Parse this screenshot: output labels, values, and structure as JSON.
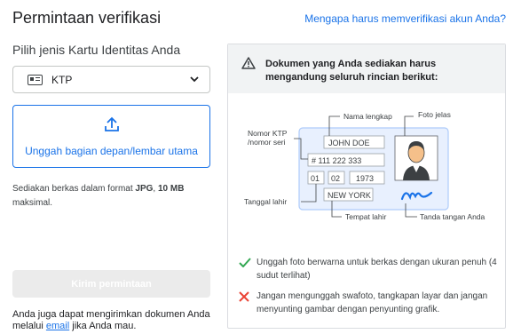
{
  "header": {
    "title": "Permintaan verifikasi",
    "why_link": "Mengapa harus memverifikasi akun Anda?"
  },
  "form": {
    "choose_label": "Pilih jenis Kartu Identitas Anda",
    "selected_id": "KTP",
    "upload_label": "Unggah bagian depan/lembar utama",
    "file_hint_prefix": "Sediakan berkas dalam format ",
    "file_hint_format": "JPG",
    "file_hint_sep": ", ",
    "file_hint_size": "10 MB",
    "file_hint_suffix": " maksimal.",
    "submit_label": "Kirim permintaan",
    "alt_prefix": "Anda juga dapat mengirimkan dokumen Anda melalui ",
    "alt_link": "email",
    "alt_suffix": " jika Anda mau."
  },
  "panel": {
    "heading": "Dokumen yang Anda sediakan harus mengandung seluruh rincian berikut:",
    "card": {
      "name": "JOHN DOE",
      "number": "# 111 222 333",
      "day": "01",
      "month": "02",
      "year": "1973",
      "place": "NEW YORK"
    },
    "callouts": {
      "full_name": "Nama lengkap",
      "photo": "Foto jelas",
      "id_number_line1": "Nomor KTP",
      "id_number_line2": "/nomor seri",
      "birth_date": "Tanggal lahir",
      "birth_place": "Tempat lahir",
      "signature": "Tanda tangan Anda"
    },
    "requirements": [
      {
        "type": "ok",
        "text": "Unggah foto berwarna untuk berkas dengan ukuran penuh (4 sudut terlihat)"
      },
      {
        "type": "bad",
        "text": "Jangan mengunggah swafoto, tangkapan layar dan jangan menyunting gambar dengan penyunting grafik."
      }
    ]
  },
  "colors": {
    "link": "#1a73e8",
    "check": "#34a853",
    "cross": "#ea4335",
    "card_bg": "#e8f0fe",
    "card_border": "#aecbfa"
  },
  "icons": {
    "select": "id-card-icon",
    "chevron": "chevron-down-icon",
    "upload": "upload-icon",
    "warning": "warning-icon",
    "ok": "check-icon",
    "bad": "cross-icon"
  }
}
